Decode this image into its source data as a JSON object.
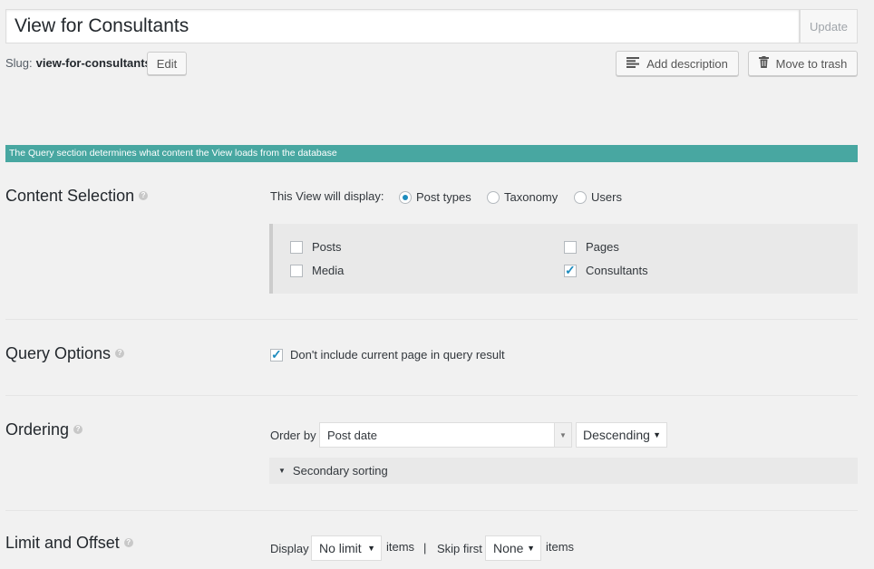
{
  "header": {
    "title_value": "View for Consultants",
    "update_label": "Update",
    "slug_label": "Slug:",
    "slug_value": "view-for-consultants",
    "edit_label": "Edit",
    "add_description_label": "Add description",
    "move_to_trash_label": "Move to trash"
  },
  "info_bar": {
    "text": "The Query section determines what content the View loads from the database"
  },
  "content_selection": {
    "title": "Content Selection",
    "display_label": "This View will display:",
    "options": [
      {
        "label": "Post types",
        "checked": true
      },
      {
        "label": "Taxonomy",
        "checked": false
      },
      {
        "label": "Users",
        "checked": false
      }
    ],
    "post_types": [
      {
        "label": "Posts",
        "checked": false
      },
      {
        "label": "Pages",
        "checked": false
      },
      {
        "label": "Media",
        "checked": false
      },
      {
        "label": "Consultants",
        "checked": true
      }
    ]
  },
  "query_options": {
    "title": "Query Options",
    "exclude_current_label": "Don't include current page in query result",
    "exclude_current_checked": true
  },
  "ordering": {
    "title": "Ordering",
    "order_by_label": "Order by",
    "order_by_value": "Post date",
    "direction_value": "Descending",
    "secondary_label": "Secondary sorting"
  },
  "limit_offset": {
    "title": "Limit and Offset",
    "display_label": "Display",
    "limit_value": "No limit",
    "items_label": "items",
    "separator": "|",
    "skip_label": "Skip first",
    "skip_value": "None",
    "items_label2": "items"
  },
  "icons": {
    "help": "question-circle-icon",
    "description": "align-left-icon",
    "trash": "trash-icon",
    "dropdown": "triangle-down-icon",
    "expand": "triangle-right-icon"
  },
  "colors": {
    "accent": "#48a7a1",
    "check": "#1e8cbe"
  }
}
